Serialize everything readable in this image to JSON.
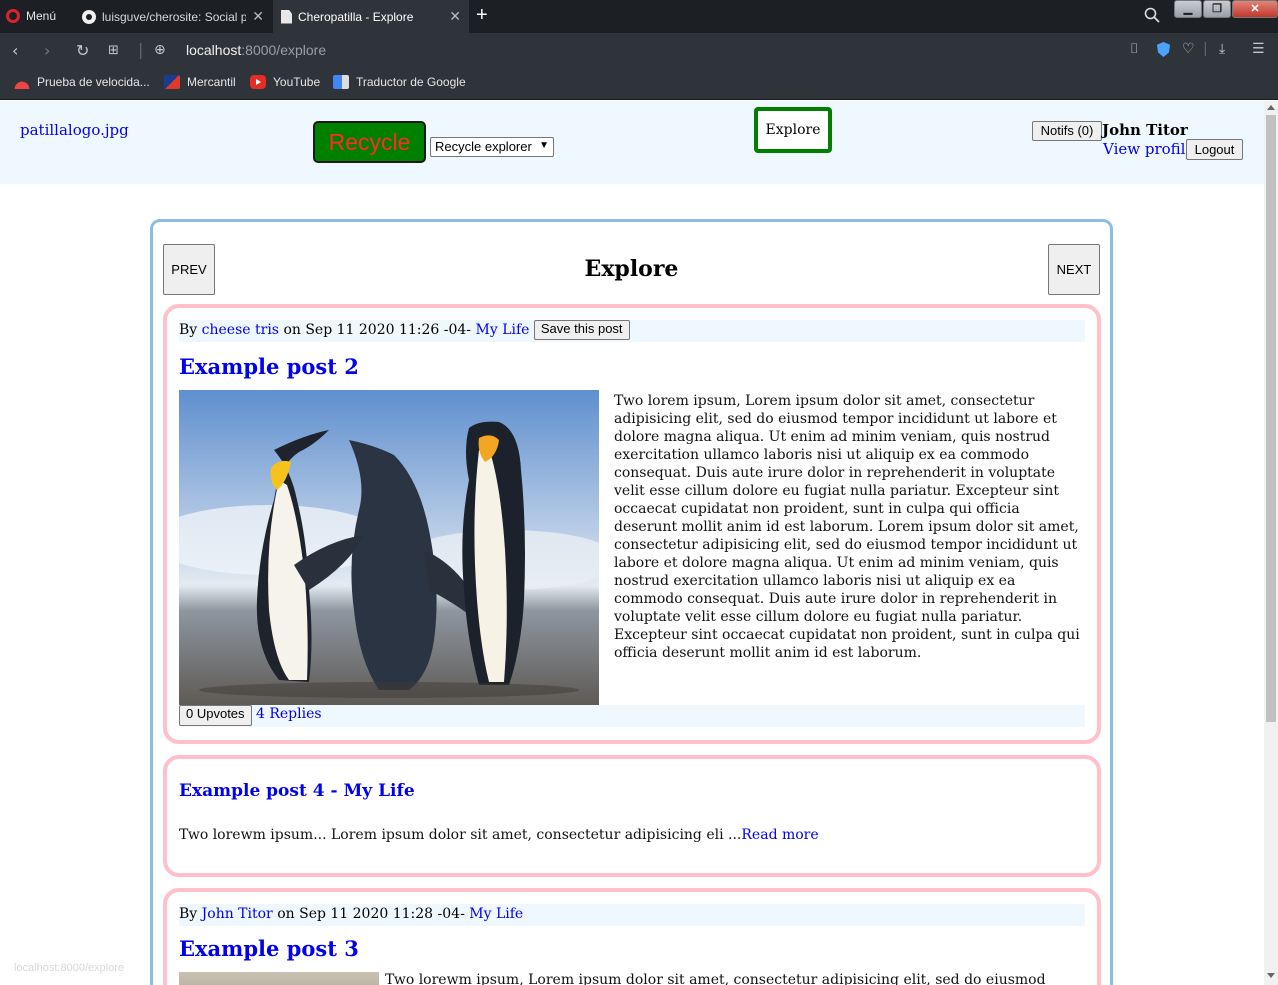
{
  "browser": {
    "menu_label": "Menú",
    "tabs": [
      {
        "title": "luisguve/cherosite: Social p",
        "icon": "github-icon"
      },
      {
        "title": "Cheropatilla - Explore",
        "icon": "page-icon"
      }
    ],
    "url_host": "localhost",
    "url_path": ":8000/explore",
    "bookmarks": [
      {
        "label": "Prueba de velocida...",
        "icon": "speedtest-icon"
      },
      {
        "label": "Mercantil",
        "icon": "mercantil-icon"
      },
      {
        "label": "YouTube",
        "icon": "youtube-icon"
      },
      {
        "label": "Traductor de Google",
        "icon": "google-translate-icon"
      }
    ],
    "status_url": "localhost:8000/explore"
  },
  "header": {
    "logo_alt": "patillalogo.jpg",
    "recycle_label": "Recycle",
    "recycle_select": "Recycle explorer",
    "explore_label": "Explore",
    "notifs_label": "Notifs (0)",
    "user_name": "John Titor",
    "view_profile": "View profile",
    "logout_label": "Logout",
    "colors": {
      "header_bg": "#f0f8ff",
      "recycle_bg": "#008000",
      "recycle_text": "#ff2a2a",
      "explore_border": "#008000"
    }
  },
  "feed": {
    "title": "Explore",
    "prev_label": "PREV",
    "next_label": "NEXT",
    "colors": {
      "feed_border": "#8bbde6",
      "post_border": "#ffc0cb"
    },
    "posts": [
      {
        "by_prefix": "By",
        "author": "cheese tris",
        "on_text": "on Sep 11 2020 11:26 -04-",
        "section": "My Life",
        "save_label": "Save this post",
        "title": "Example post 2",
        "body": "Two lorem ipsum, Lorem ipsum dolor sit amet, consectetur adipisicing elit, sed do eiusmod tempor incididunt ut labore et dolore magna aliqua. Ut enim ad minim veniam, quis nostrud exercitation ullamco laboris nisi ut aliquip ex ea commodo consequat. Duis aute irure dolor in reprehenderit in voluptate velit esse cillum dolore eu fugiat nulla pariatur. Excepteur sint occaecat cupidatat non proident, sunt in culpa qui officia deserunt mollit anim id est laborum. Lorem ipsum dolor sit amet, consectetur adipisicing elit, sed do eiusmod tempor incididunt ut labore et dolore magna aliqua. Ut enim ad minim veniam, quis nostrud exercitation ullamco laboris nisi ut aliquip ex ea commodo consequat. Duis aute irure dolor in reprehenderit in voluptate velit esse cillum dolore eu fugiat nulla pariatur. Excepteur sint occaecat cupidatat non proident, sunt in culpa qui officia deserunt mollit anim id est laborum.",
        "upvotes_label": "0 Upvotes",
        "replies_label": "4 Replies"
      },
      {
        "title": "Example post 4",
        "title_sep": " - ",
        "section": "My Life",
        "excerpt": "Two lorewm ipsum... Lorem ipsum dolor sit amet, consectetur adipisicing eli ...",
        "read_more": "Read more"
      },
      {
        "by_prefix": "By",
        "author": "John Titor",
        "on_text": "on Sep 11 2020 11:28 -04-",
        "section": "My Life",
        "title": "Example post 3",
        "body_start": "Two lorewm ipsum, Lorem ipsum dolor sit amet, consectetur adipisicing elit, sed do eiusmod"
      }
    ]
  }
}
